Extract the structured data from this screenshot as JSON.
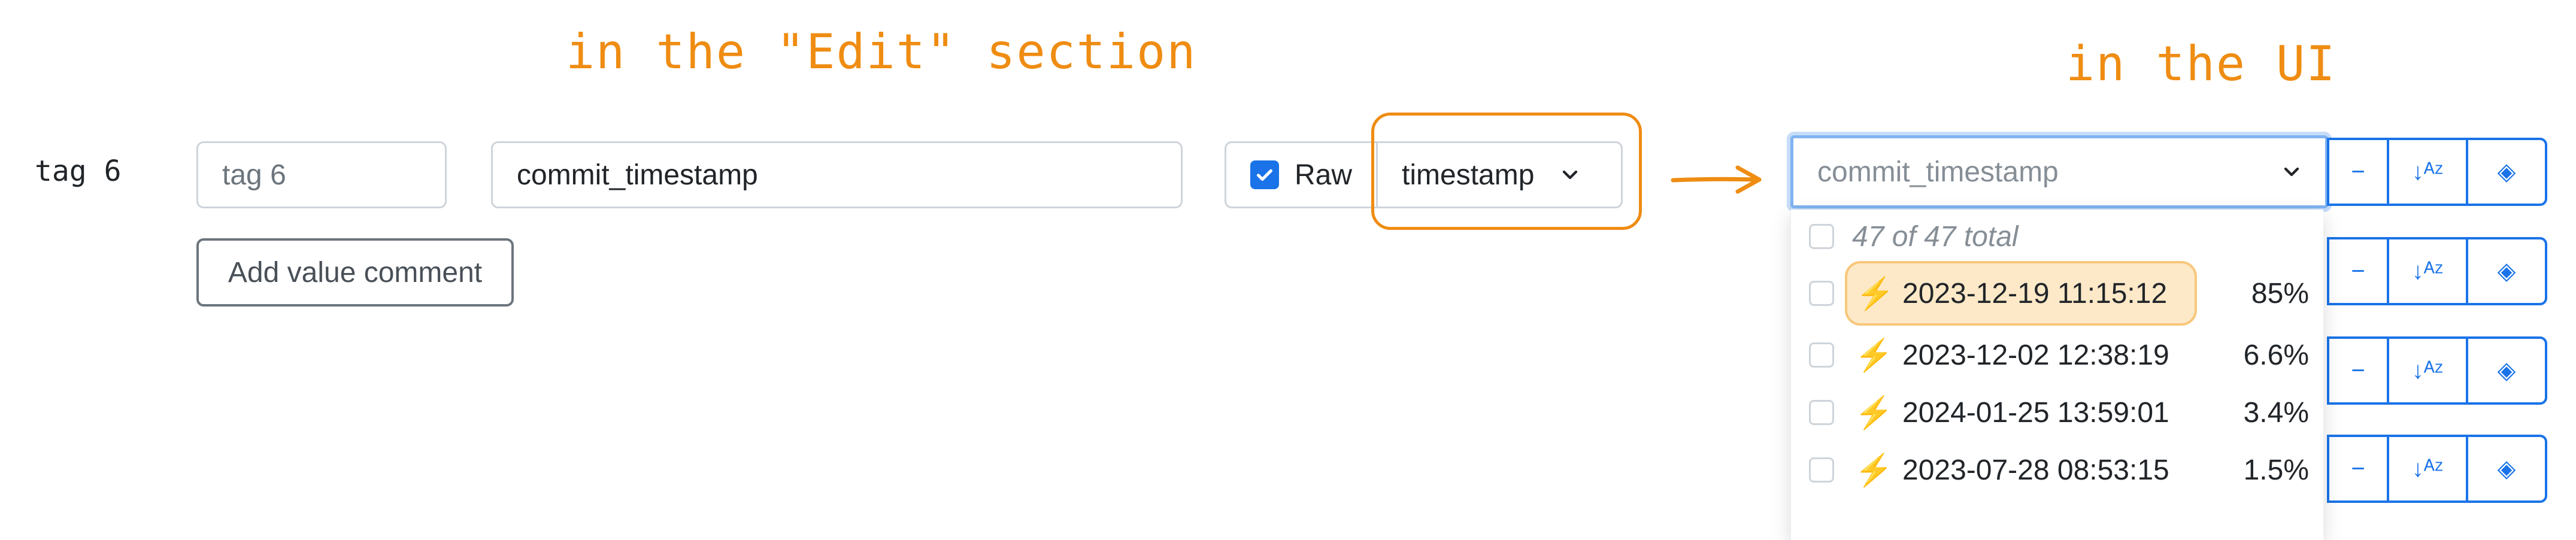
{
  "annotations": {
    "edit": "in the \"Edit\" section",
    "ui": "in the UI"
  },
  "edit": {
    "tag_label": "tag 6",
    "name_input_value": "tag 6",
    "field_input_value": "commit_timestamp",
    "add_comment_button": "Add value comment",
    "raw_label": "Raw",
    "raw_checked": true,
    "type_select_value": "timestamp"
  },
  "ui": {
    "filter_placeholder": "commit_timestamp",
    "total_text": "47 of 47 total",
    "options": [
      {
        "value": "2023-12-19 11:15:12",
        "percent": "85%",
        "highlighted": true
      },
      {
        "value": "2023-12-02 12:38:19",
        "percent": "6.6%"
      },
      {
        "value": "2024-01-25 13:59:01",
        "percent": "3.4%"
      },
      {
        "value": "2023-07-28 08:53:15",
        "percent": "1.5%"
      }
    ]
  },
  "colors": {
    "annotation": "#ef8c12",
    "accent": "#1a73e8",
    "bolt": "#f5b41b"
  }
}
